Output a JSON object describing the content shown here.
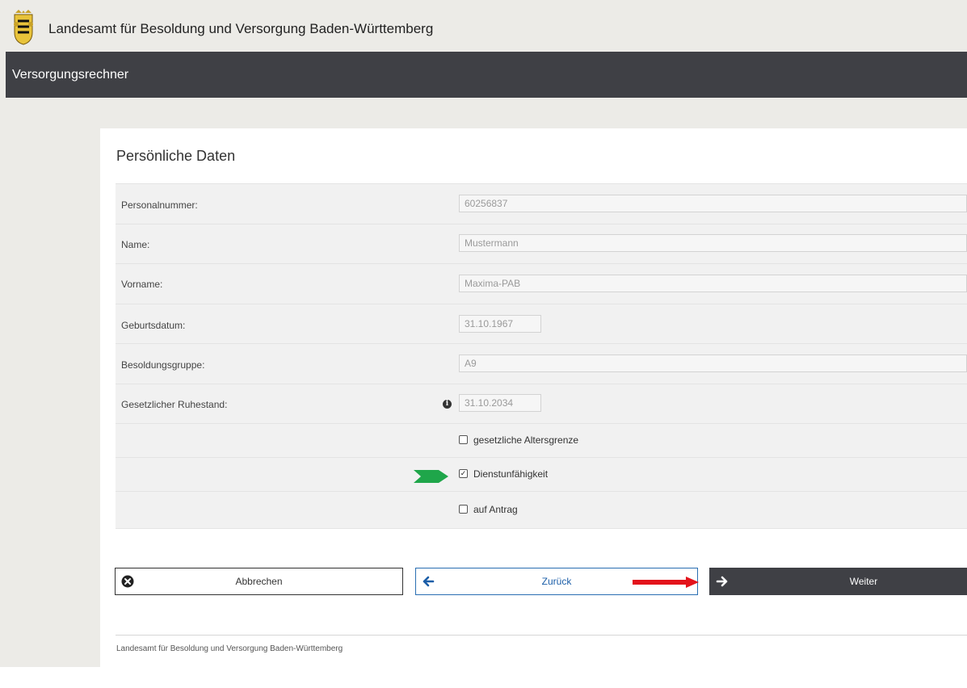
{
  "header": {
    "org_title": "Landesamt für Besoldung und Versorgung Baden-Württemberg",
    "crest_icon": "coat-of-arms-icon"
  },
  "appbar": {
    "title": "Versorgungsrechner"
  },
  "section": {
    "title": "Persönliche Daten"
  },
  "form": {
    "personalnummer": {
      "label": "Personalnummer:",
      "value": "60256837"
    },
    "name": {
      "label": "Name:",
      "value": "Mustermann"
    },
    "vorname": {
      "label": "Vorname:",
      "value": "Maxima-PAB"
    },
    "geburtsdatum": {
      "label": "Geburtsdatum:",
      "value": "31.10.1967"
    },
    "besoldungsgruppe": {
      "label": "Besoldungsgruppe:",
      "value": "A9"
    },
    "ruhestand": {
      "label": "Gesetzlicher Ruhestand:",
      "value": "31.10.2034",
      "info_icon": "info-icon"
    },
    "options": [
      {
        "label": "gesetzliche Altersgrenze",
        "checked": false
      },
      {
        "label": "Dienstunfähigkeit",
        "checked": true
      },
      {
        "label": "auf Antrag",
        "checked": false
      }
    ]
  },
  "buttons": {
    "cancel_label": "Abbrechen",
    "cancel_icon": "close-circle-icon",
    "back_label": "Zurück",
    "back_icon": "arrow-left-icon",
    "next_label": "Weiter",
    "next_icon": "arrow-right-icon"
  },
  "annotations": {
    "green_arrow_color": "#1fa64a",
    "red_arrow_color": "#e3131b"
  },
  "footer": {
    "text": "Landesamt für Besoldung und Versorgung Baden-Württemberg"
  },
  "colors": {
    "appbar_bg": "#3f4045",
    "page_bg": "#ecebe7",
    "back_button_accent": "#1b5ea8"
  }
}
